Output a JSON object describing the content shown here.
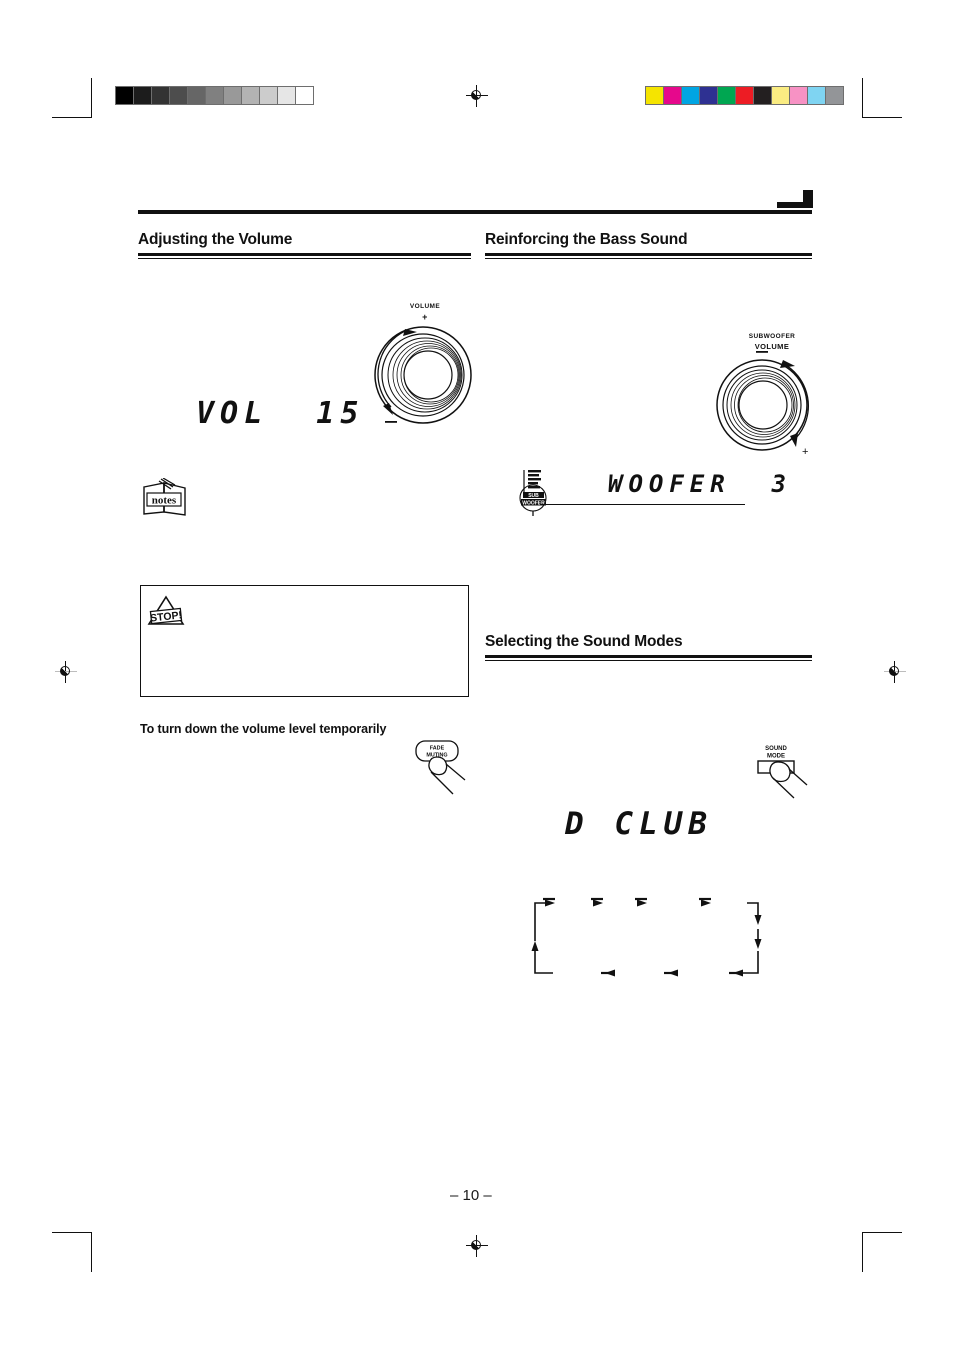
{
  "page": {
    "number_label": "– 10 –",
    "corner_flag_icon": "corner-arrow-flag"
  },
  "print_marks": {
    "grayscale_strip": {
      "name": "grayscale-calibration-strip",
      "swatches": [
        "#000000",
        "#1c1c1c",
        "#333333",
        "#4d4d4d",
        "#666666",
        "#808080",
        "#999999",
        "#b3b3b3",
        "#cccccc",
        "#e6e6e6",
        "#ffffff"
      ]
    },
    "color_strip": {
      "name": "color-calibration-strip",
      "swatches": [
        "#f5e400",
        "#e6088c",
        "#00a5e3",
        "#2e3192",
        "#00a651",
        "#ed1c24",
        "#231f20",
        "#faec82",
        "#f792c4",
        "#7fd4f2",
        "#939598"
      ]
    },
    "registration_icon": "registration-target-icon"
  },
  "sections": {
    "adjusting_volume": {
      "title": "Adjusting the Volume",
      "display": "VOL  15",
      "knob": {
        "label_line1": "VOLUME",
        "plus": "+",
        "minus": "–"
      },
      "notes_icon": "notes-book-icon",
      "caution_icon": "stop-caution-icon",
      "subhead": "To turn down the volume level temporarily",
      "button": {
        "label_line1": "FADE",
        "label_line2": "MUTING",
        "icon": "hand-press-icon"
      }
    },
    "reinforcing_bass": {
      "title": "Reinforcing the Bass Sound",
      "display": "WOOFER  3",
      "knob": {
        "label_line1": "SUBWOOFER",
        "label_line2": "VOLUME",
        "plus": "+",
        "minus": "–"
      },
      "callout_icon": "subwoofer-button-icon"
    },
    "selecting_sound_modes": {
      "title": "Selecting the Sound Modes",
      "display": "D CLUB",
      "button": {
        "label_line1": "SOUND",
        "label_line2": "MODE",
        "icon": "hand-press-icon"
      },
      "flow": {
        "name": "sound-mode-cycle-diagram",
        "top_row": [
          "",
          "",
          "",
          ""
        ],
        "bottom_row": [
          "",
          "",
          ""
        ]
      }
    }
  }
}
